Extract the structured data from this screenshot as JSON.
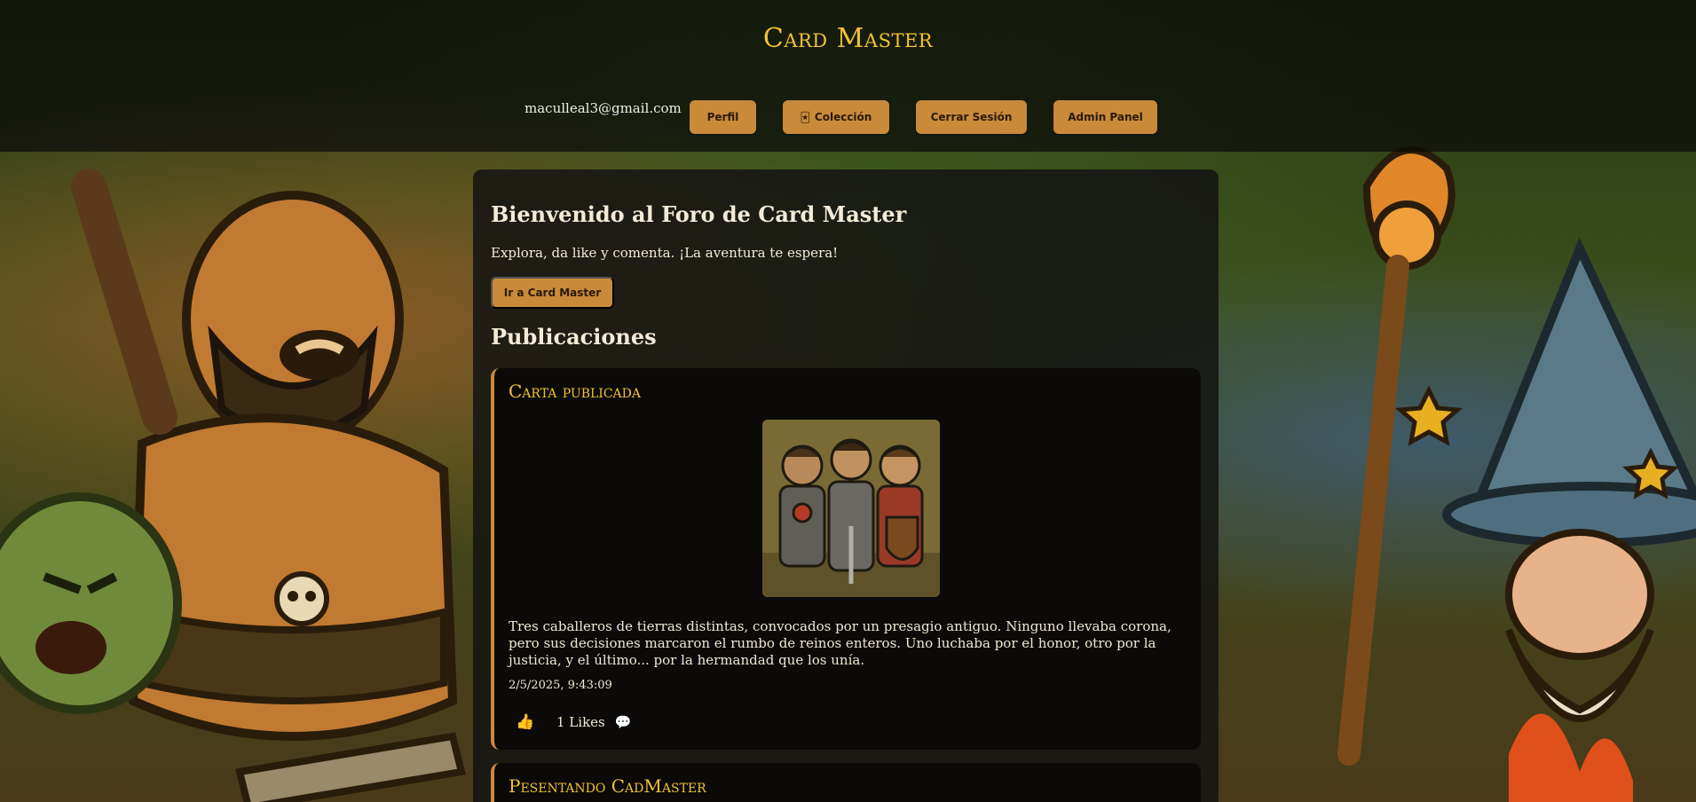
{
  "app": {
    "title": "Card Master"
  },
  "header": {
    "user_email": "maculleal3@gmail.com",
    "buttons": {
      "perfil": "Perfil",
      "coleccion": "Colección",
      "cerrar_sesion": "Cerrar Sesión",
      "admin_panel": "Admin Panel"
    },
    "coleccion_icon": "card-icon"
  },
  "welcome": {
    "title": "Bienvenido al Foro de Card Master",
    "subtitle": "Explora, da like y comenta. ¡La aventura te espera!",
    "button": "Ir a Card Master"
  },
  "posts_section": {
    "title": "Publicaciones"
  },
  "posts": [
    {
      "title": "Carta publicada",
      "image": "three-knights-card-art",
      "body": "Tres caballeros de tierras distintas, convocados por un presagio antiguo. Ninguno llevaba corona, pero sus decisiones marcaron el rumbo de reinos enteros. Uno luchaba por el honor, otro por la justicia, y el último... por la hermandad que los unía.",
      "date": "2/5/2025, 9:43:09",
      "likes": "1 Likes",
      "like_icon": "thumbs-up-icon",
      "comment_icon": "comment-icon"
    },
    {
      "title": "Pesentando CadMaster"
    }
  ],
  "colors": {
    "accent": "#c98a3a",
    "title_gold": "#f2c230",
    "panel_bg": "#141412",
    "post_bg": "#0b0a08"
  }
}
